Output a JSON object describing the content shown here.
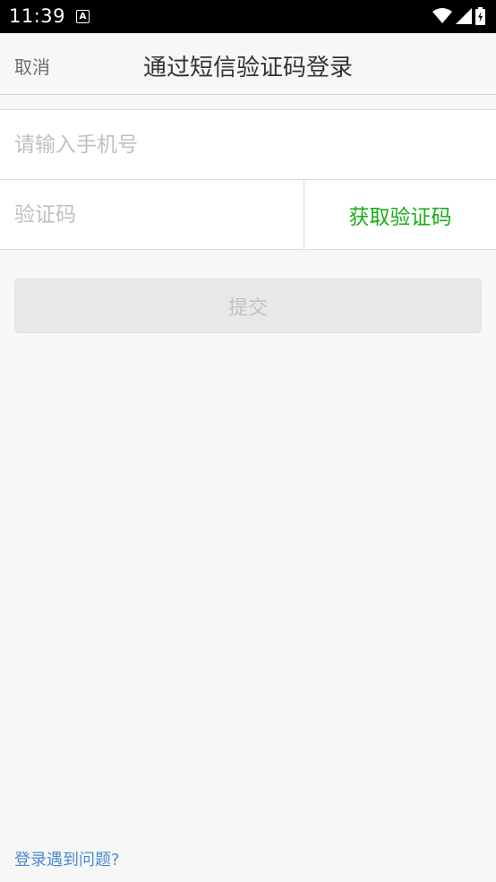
{
  "status_bar": {
    "time": "11:39",
    "app_icon_letter": "A",
    "icons": [
      "wifi-icon",
      "signal-icon",
      "battery-charging-icon"
    ]
  },
  "nav": {
    "cancel_label": "取消",
    "title": "通过短信验证码登录"
  },
  "form": {
    "phone_placeholder": "请输入手机号",
    "phone_value": "",
    "code_placeholder": "验证码",
    "code_value": "",
    "get_code_label": "获取验证码"
  },
  "submit_label": "提交",
  "help_link": "登录遇到问题?",
  "colors": {
    "accent_green": "#1aad19",
    "link_blue": "#4a8ad1",
    "background": "#f7f7f7"
  }
}
